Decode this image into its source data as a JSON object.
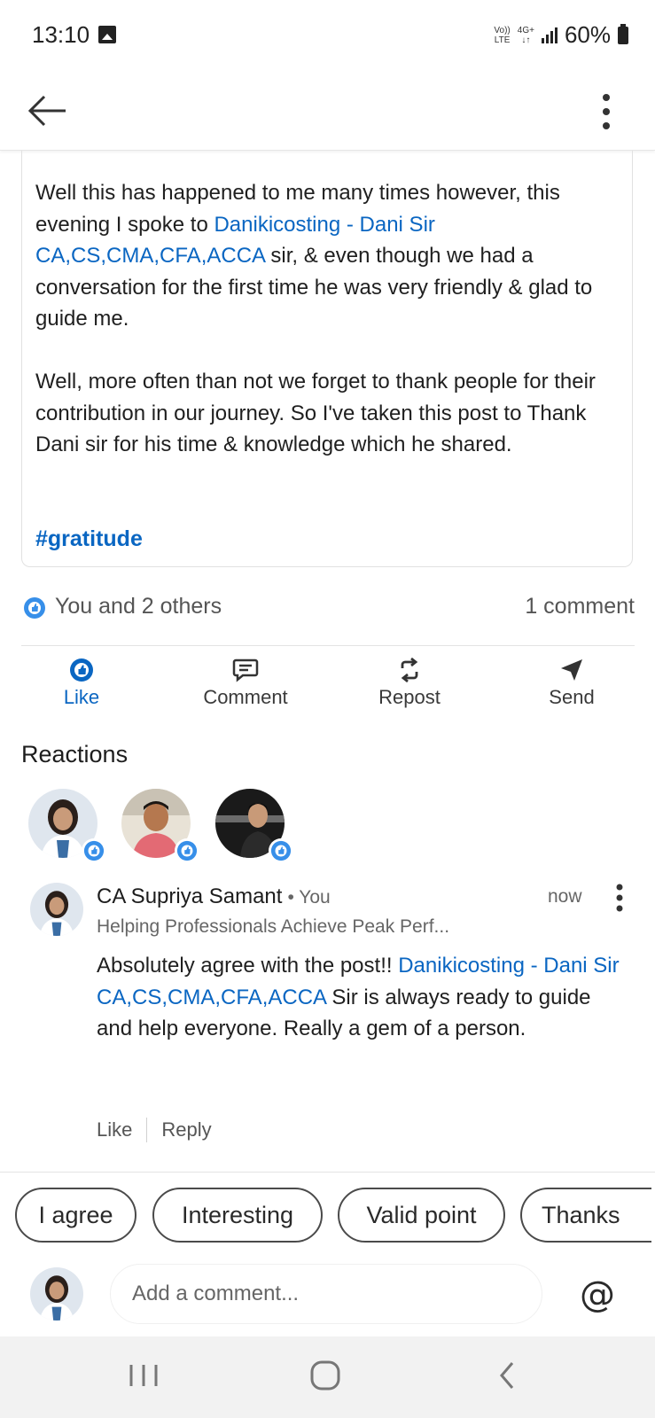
{
  "status_bar": {
    "time": "13:10",
    "network_top": "Vo))",
    "network_bottom": "LTE",
    "data_type": "4G+",
    "battery": "60%"
  },
  "app_bar": {
    "back_icon": "back-arrow-icon",
    "more_icon": "vertical-dots-icon"
  },
  "post": {
    "para1_start": "Well this has happened to me many times however, this evening I spoke to ",
    "mention1": "Danikicosting - Dani Sir CA,CS,CMA,CFA,ACCA",
    "para1_end": " sir, & even though we had a conversation for the first time he was very friendly & glad to guide me.",
    "para2": "Well, more often than not we forget to thank people for their contribution in our journey. So I've taken this post to Thank Dani sir for his time & knowledge which he shared.",
    "hashtag": "#gratitude"
  },
  "social": {
    "reaction_summary": "You and 2 others",
    "comment_count": "1 comment"
  },
  "actions": {
    "like": "Like",
    "comment": "Comment",
    "repost": "Repost",
    "send": "Send"
  },
  "reactions": {
    "title": "Reactions"
  },
  "comment": {
    "name": "CA Supriya Samant",
    "you_label": "• You",
    "time": "now",
    "headline": "Helping Professionals Achieve Peak Perf...",
    "text_start": "Absolutely  agree with the post!! ",
    "mention": "Danikicosting - Dani Sir CA,CS,CMA,CFA,ACCA",
    "text_end": "  Sir is always ready to guide and help everyone. Really a gem of a person.",
    "like": "Like",
    "reply": "Reply"
  },
  "chips": [
    "I agree",
    "Interesting",
    "Valid point",
    "Thanks"
  ],
  "compose": {
    "placeholder": "Add a comment...",
    "mention_button": "@"
  },
  "colors": {
    "link": "#0a66c2",
    "background": "#ffffff",
    "nav_bar": "#f2f2f2"
  }
}
